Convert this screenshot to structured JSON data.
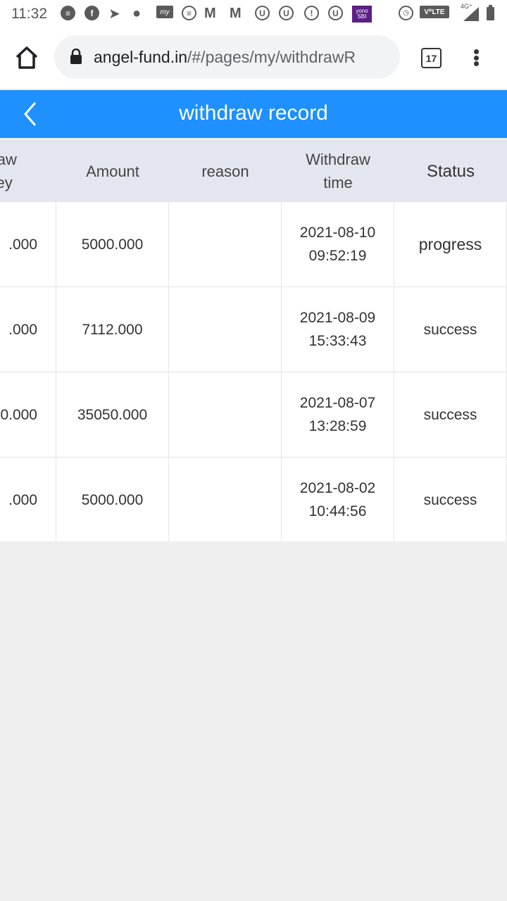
{
  "status_bar": {
    "time": "11:32",
    "my_icon_label": "my",
    "yono_label_top": "yono",
    "yono_label_bottom": "SBI",
    "volte_label": "V⁰LTE",
    "network_label": "4G⁺",
    "icons": [
      "message-icon",
      "facebook-icon",
      "telegram-icon",
      "food-app-icon",
      "my-app-icon",
      "chat-icon",
      "gmail-icon",
      "gmail-icon",
      "u-app-icon",
      "u-app-icon",
      "alert-icon",
      "u-app-icon",
      "yono-sbi-icon",
      "alarm-icon",
      "volte-icon",
      "signal-icon",
      "battery-icon"
    ]
  },
  "browser": {
    "url_host": "angel-fund.in",
    "url_path": "/#/pages/my/withdrawR",
    "tab_count": "17"
  },
  "header": {
    "title": "withdraw record"
  },
  "table": {
    "columns": [
      {
        "line1": "draw",
        "line2": "ney"
      },
      {
        "line1": "Amount",
        "line2": ""
      },
      {
        "line1": "reason",
        "line2": ""
      },
      {
        "line1": "Withdraw",
        "line2": "time"
      },
      {
        "line1": "Status",
        "line2": ""
      }
    ],
    "rows": [
      {
        "withdraw_money": ".000",
        "amount": "5000.000",
        "reason": "",
        "date": "2021-08-10",
        "time": "09:52:19",
        "status": "progress"
      },
      {
        "withdraw_money": ".000",
        "amount": "7112.000",
        "reason": "",
        "date": "2021-08-09",
        "time": "15:33:43",
        "status": "success"
      },
      {
        "withdraw_money": "0.000",
        "amount": "35050.000",
        "reason": "",
        "date": "2021-08-07",
        "time": "13:28:59",
        "status": "success"
      },
      {
        "withdraw_money": ".000",
        "amount": "5000.000",
        "reason": "",
        "date": "2021-08-02",
        "time": "10:44:56",
        "status": "success"
      }
    ]
  },
  "colors": {
    "header_blue": "#1e90ff",
    "table_header_bg": "#e4e6ef",
    "page_bg": "#efefef"
  }
}
